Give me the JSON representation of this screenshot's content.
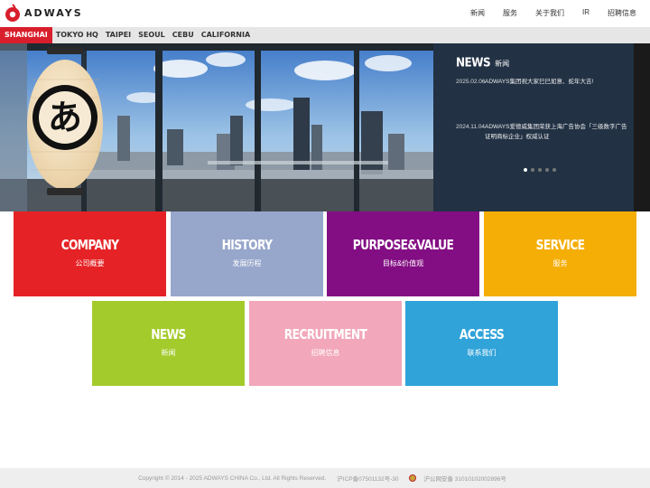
{
  "header": {
    "logo_text": "ADWAYS",
    "nav": [
      "新闻",
      "服务",
      "关于我们",
      "IR",
      "招聘信息"
    ]
  },
  "locations": {
    "active": "SHANGHAI",
    "items": [
      "TOKYO HQ",
      "TAIPEI",
      "SEOUL",
      "CEBU",
      "CALIFORNIA"
    ]
  },
  "hero": {
    "lantern_glyph": "あ",
    "news_title_en": "NEWS",
    "news_title_cn": "新闻",
    "news": [
      {
        "date": "2025.02.06",
        "text": "ADWAYS集团祝大家巳巳如意、蛇年大吉!"
      },
      {
        "date": "2024.11.04",
        "text": "ADWAYS爱德威集团荣获上海广告协会「三级数字广告证明商标企业」权威认证"
      }
    ],
    "slides": 5,
    "active_slide": 1
  },
  "tiles": [
    {
      "en": "COMPANY",
      "cn": "公司概要",
      "color": "#e52326"
    },
    {
      "en": "HISTORY",
      "cn": "发展历程",
      "color": "#97a6cb"
    },
    {
      "en": "PURPOSE&VALUE",
      "cn": "目标&价值观",
      "color": "#830e83"
    },
    {
      "en": "SERVICE",
      "cn": "服务",
      "color": "#f5ae06"
    },
    {
      "en": "NEWS",
      "cn": "新闻",
      "color": "#a3cb2c"
    },
    {
      "en": "RECRUITMENT",
      "cn": "招聘信息",
      "color": "#f2a7ba"
    },
    {
      "en": "ACCESS",
      "cn": "联系我们",
      "color": "#30a3d9"
    }
  ],
  "footer": {
    "copyright": "Copyright © 2014 - 2025 ADWAYS CHINA Co., Ltd. All Rights Reserved.",
    "icp": "沪ICP备07501132号-30",
    "police": "沪公网安备 31010102002896号"
  }
}
